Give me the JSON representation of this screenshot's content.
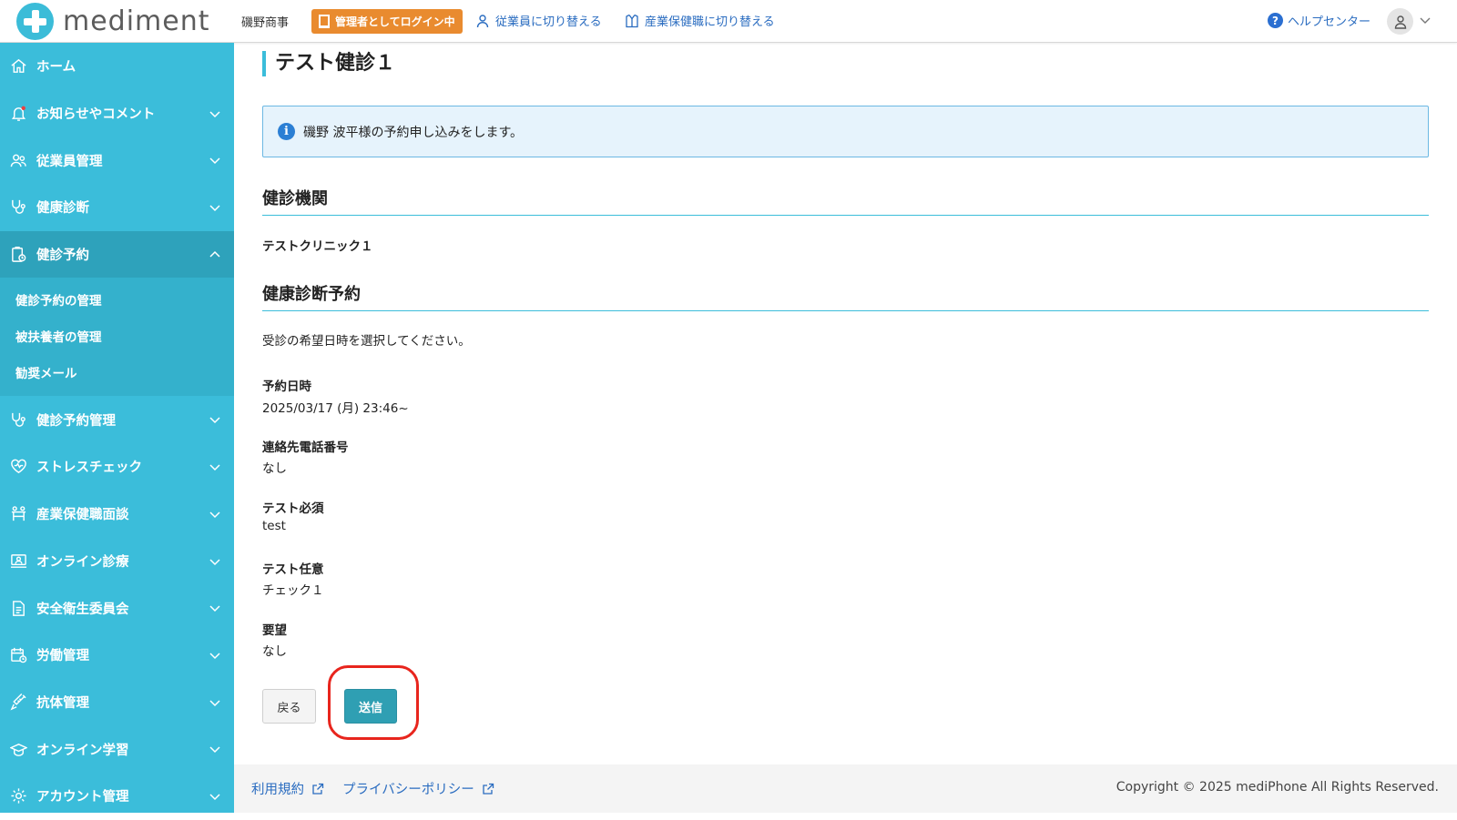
{
  "header": {
    "logo_text": "mediment",
    "company": "磯野商事",
    "admin_badge": "管理者としてログイン中",
    "switch_employee": "従業員に切り替える",
    "switch_occupational": "産業保健職に切り替える",
    "help_center": "ヘルプセンター"
  },
  "sidebar": {
    "items": [
      {
        "label": "ホーム"
      },
      {
        "label": "お知らせやコメント"
      },
      {
        "label": "従業員管理"
      },
      {
        "label": "健康診断"
      },
      {
        "label": "健診予約"
      },
      {
        "label": "健診予約管理"
      },
      {
        "label": "ストレスチェック"
      },
      {
        "label": "産業保健職面談"
      },
      {
        "label": "オンライン診療"
      },
      {
        "label": "安全衛生委員会"
      },
      {
        "label": "労働管理"
      },
      {
        "label": "抗体管理"
      },
      {
        "label": "オンライン学習"
      },
      {
        "label": "アカウント管理"
      }
    ],
    "submenu": [
      {
        "label": "健診予約の管理"
      },
      {
        "label": "被扶養者の管理"
      },
      {
        "label": "勧奨メール"
      }
    ]
  },
  "main": {
    "title": "テスト健診１",
    "info": "磯野 波平様の予約申し込みをします。",
    "section_institution": "健診機関",
    "institution_name": "テストクリニック１",
    "section_reservation": "健康診断予約",
    "instruction": "受診の希望日時を選択してください。",
    "fields": [
      {
        "label": "予約日時",
        "value": "2025/03/17 (月) 23:46~"
      },
      {
        "label": "連絡先電話番号",
        "value": "なし"
      },
      {
        "label": "テスト必須",
        "value": "test"
      },
      {
        "label": "テスト任意",
        "value": "チェック１"
      },
      {
        "label": "要望",
        "value": "なし"
      }
    ],
    "back_button": "戻る",
    "submit_button": "送信"
  },
  "footer": {
    "terms": "利用規約",
    "privacy": "プライバシーポリシー",
    "copyright": "Copyright © 2025 mediPhone All Rights Reserved."
  },
  "colors": {
    "sidebar": "#3bbdda",
    "sidebar_active": "#2ea2bb",
    "admin_badge": "#e98b2f",
    "submit": "#2f9fb3",
    "highlight": "#e8251d",
    "link": "#2a6cc0"
  }
}
